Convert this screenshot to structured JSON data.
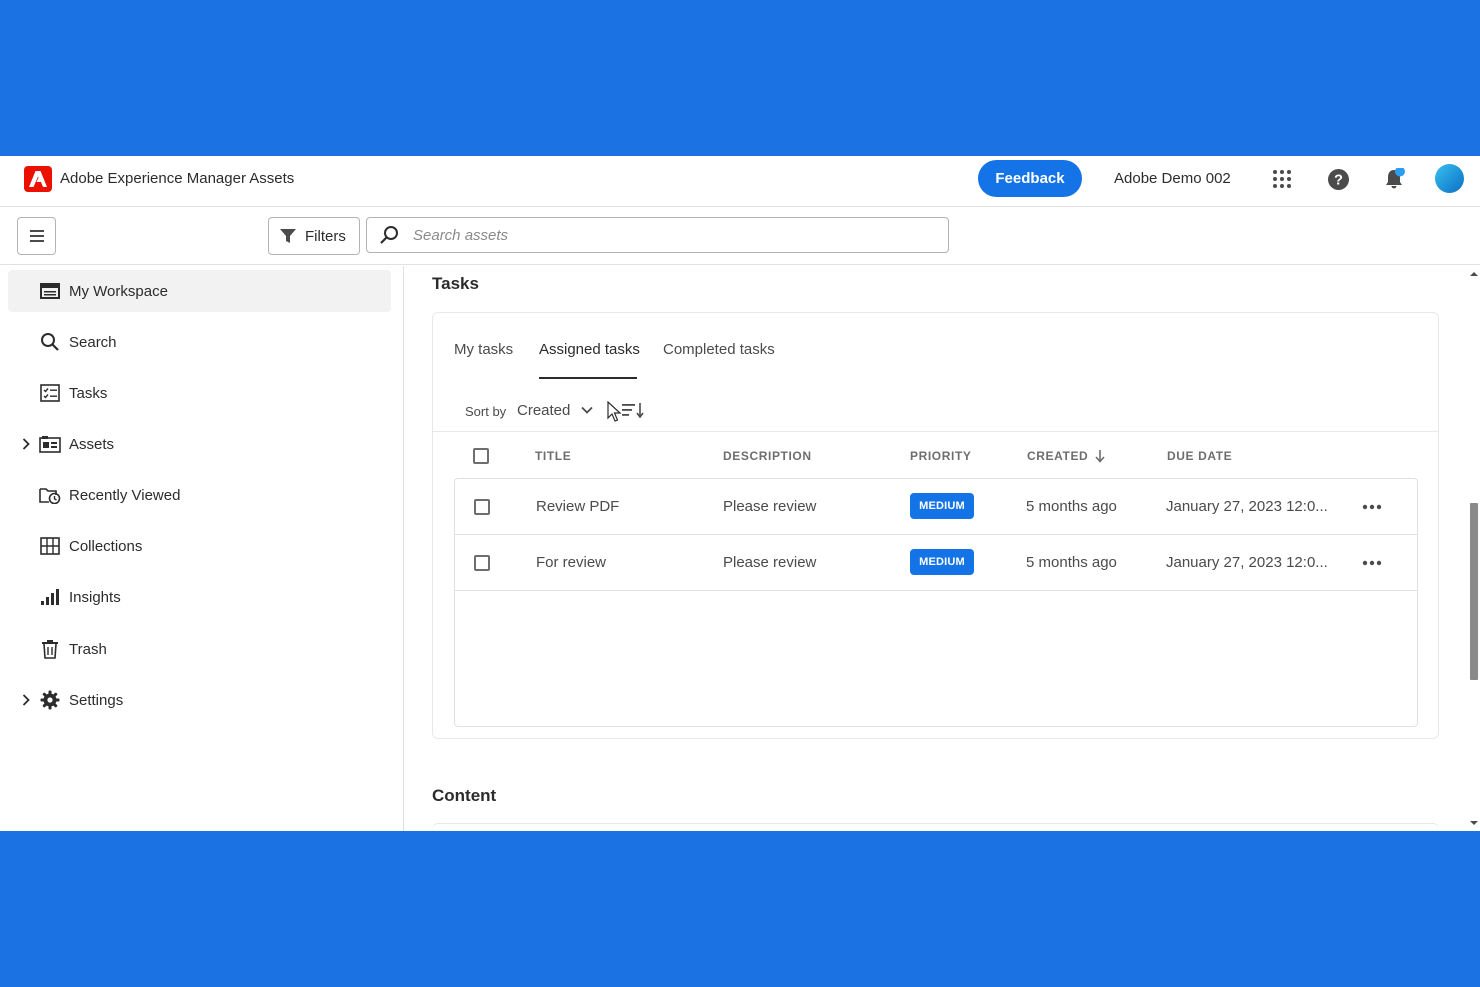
{
  "header": {
    "app_title": "Adobe Experience Manager Assets",
    "feedback_label": "Feedback",
    "org_name": "Adobe Demo 002",
    "icons": [
      "app-switcher-icon",
      "help-icon",
      "notifications-icon",
      "user-avatar"
    ]
  },
  "toolbar": {
    "filters_label": "Filters",
    "search_placeholder": "Search assets"
  },
  "sidebar": {
    "items": [
      {
        "label": "My Workspace",
        "icon": "workspace-icon",
        "selected": true
      },
      {
        "label": "Search",
        "icon": "search-icon"
      },
      {
        "label": "Tasks",
        "icon": "tasks-icon"
      },
      {
        "label": "Assets",
        "icon": "assets-icon",
        "expandable": true
      },
      {
        "label": "Recently Viewed",
        "icon": "recently-viewed-icon"
      },
      {
        "label": "Collections",
        "icon": "collections-icon"
      },
      {
        "label": "Insights",
        "icon": "insights-icon"
      },
      {
        "label": "Trash",
        "icon": "trash-icon"
      },
      {
        "label": "Settings",
        "icon": "settings-icon",
        "expandable": true
      }
    ]
  },
  "tasks": {
    "section_title": "Tasks",
    "tabs": [
      {
        "label": "My tasks"
      },
      {
        "label": "Assigned tasks",
        "active": true
      },
      {
        "label": "Completed tasks"
      }
    ],
    "sort_label": "Sort by",
    "sort_value": "Created",
    "columns": [
      "TITLE",
      "DESCRIPTION",
      "PRIORITY",
      "CREATED",
      "DUE DATE"
    ],
    "rows": [
      {
        "title": "Review PDF",
        "description": "Please review",
        "priority": "MEDIUM",
        "created": "5 months ago",
        "due": "January 27, 2023 12:0..."
      },
      {
        "title": "For review",
        "description": "Please review",
        "priority": "MEDIUM",
        "created": "5 months ago",
        "due": "January 27, 2023 12:0..."
      }
    ]
  },
  "content": {
    "section_title": "Content"
  },
  "colors": {
    "background": "#1b73e3",
    "accent": "#1473e6",
    "logo": "#eb1000"
  }
}
